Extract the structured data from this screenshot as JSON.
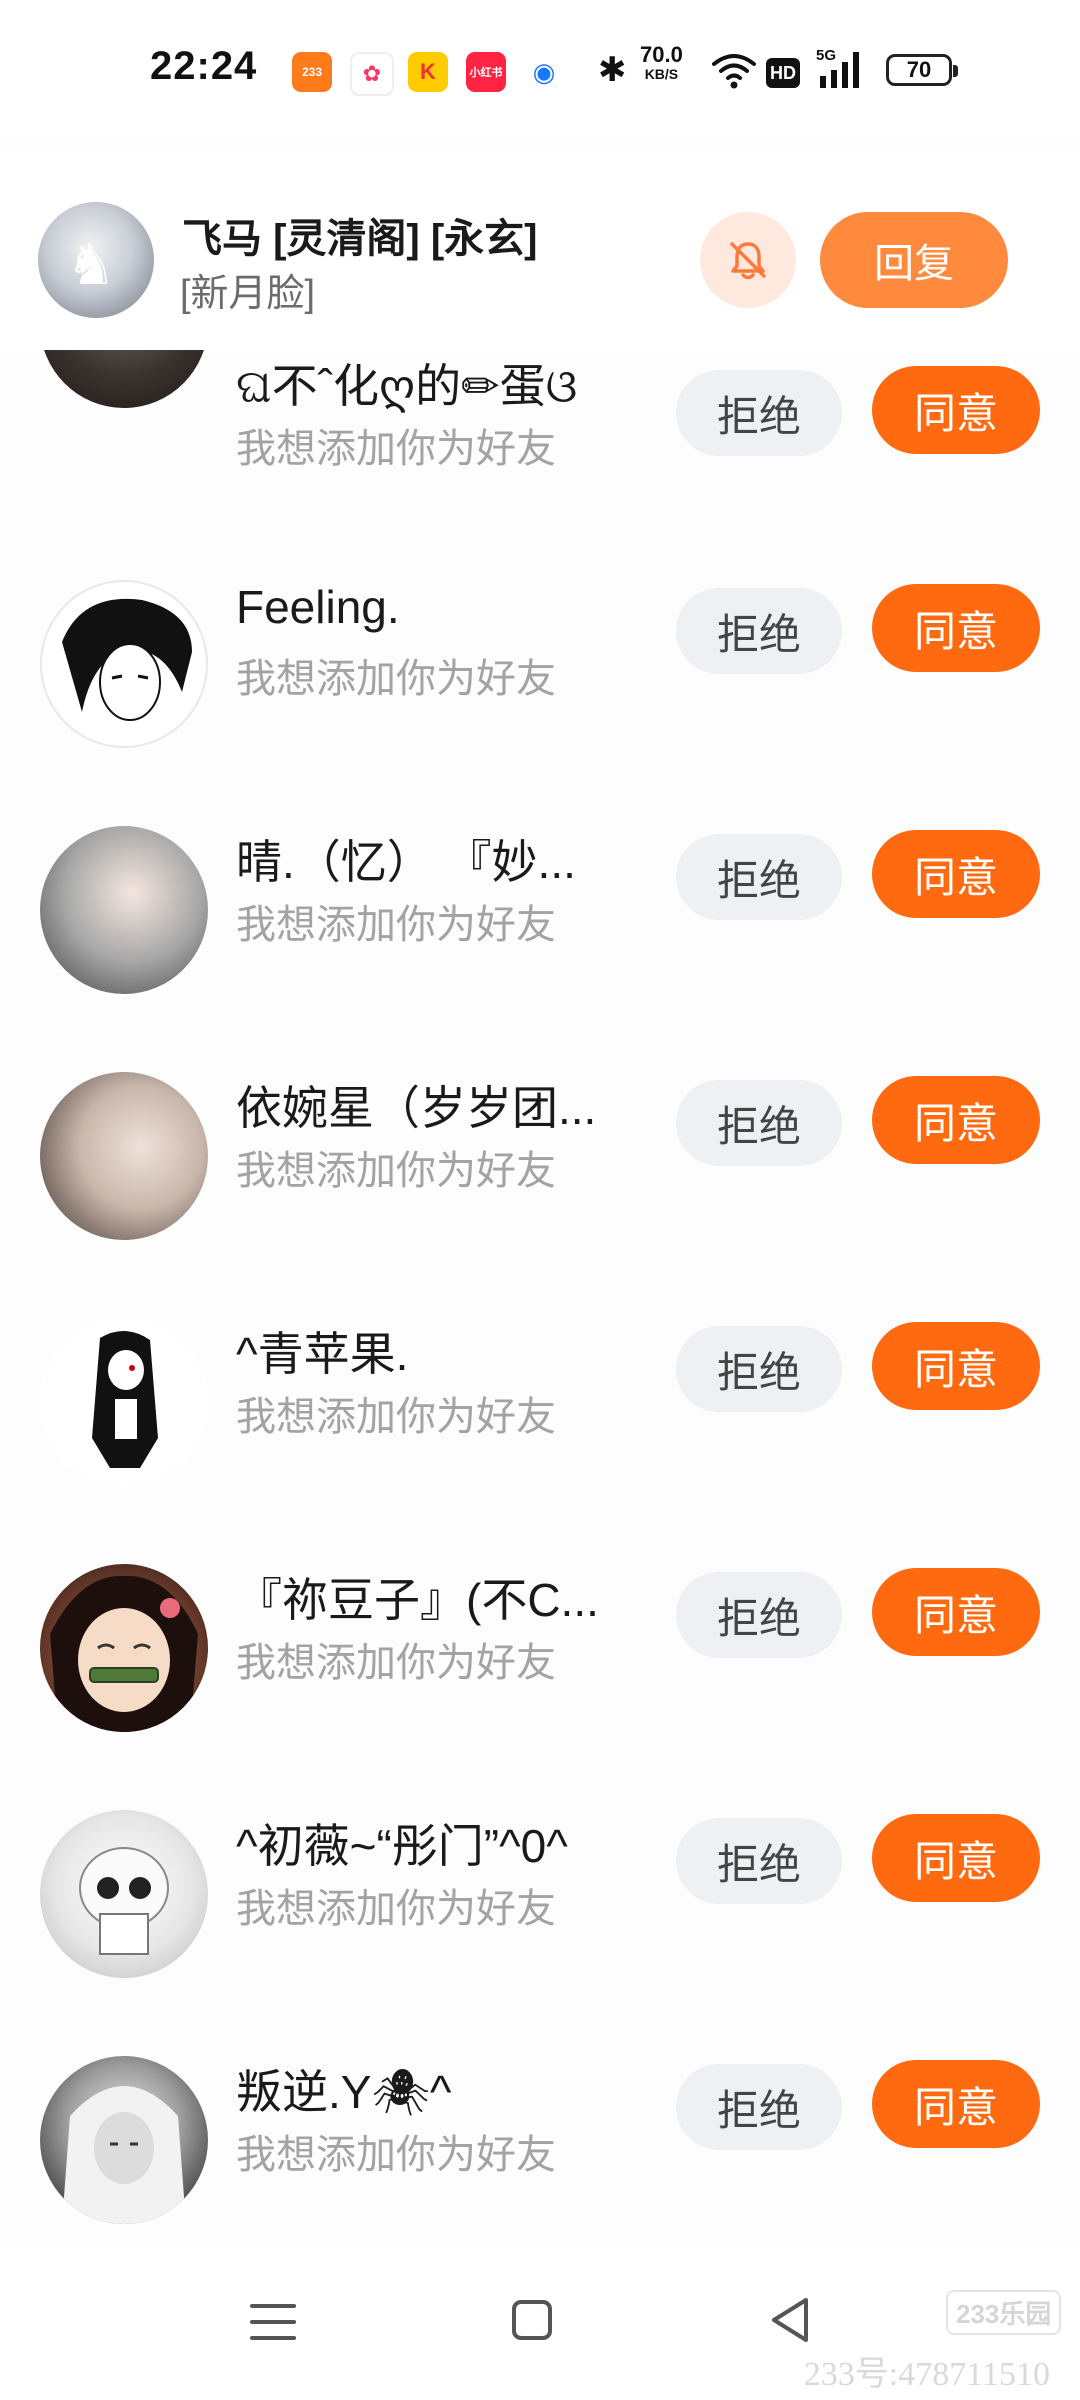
{
  "status_bar": {
    "time": "22:24",
    "app_icons": [
      "233",
      "✿",
      "K",
      "小红书",
      "◉"
    ],
    "net_speed": "70.0",
    "net_speed_unit": "KB/S",
    "hd_label": "HD",
    "signal_label": "5G",
    "battery": "70"
  },
  "notification": {
    "title": "飞马 [灵清阁] [永玄]",
    "subtitle": "[新月脸]",
    "reply_label": "回复",
    "accent_color": "#ff8a3d"
  },
  "request_defaults": {
    "reject_label": "拒绝",
    "accept_label": "同意",
    "accept_color": "#ff6a10"
  },
  "requests": [
    {
      "name": "ଘ不ˆ化ღ的✏蛋ଓ",
      "message": "我想添加你为好友",
      "reject_label": "拒绝",
      "accept_label": "同意"
    },
    {
      "name": "Feeling.",
      "message": "我想添加你为好友",
      "reject_label": "拒绝",
      "accept_label": "同意"
    },
    {
      "name": "晴.（忆）  『妙...",
      "message": "我想添加你为好友",
      "reject_label": "拒绝",
      "accept_label": "同意"
    },
    {
      "name": "依婉星（岁岁团...",
      "message": "我想添加你为好友",
      "reject_label": "拒绝",
      "accept_label": "同意"
    },
    {
      "name": "^青苹果.",
      "message": "我想添加你为好友",
      "reject_label": "拒绝",
      "accept_label": "同意"
    },
    {
      "name": "『祢豆子』(不C...",
      "message": "我想添加你为好友",
      "reject_label": "拒绝",
      "accept_label": "同意"
    },
    {
      "name": "^初薇~“彤门”^0^",
      "message": "我想添加你为好友",
      "reject_label": "拒绝",
      "accept_label": "同意"
    },
    {
      "name": "叛逆.Y🕷^",
      "message": "我想添加你为好友",
      "reject_label": "拒绝",
      "accept_label": "同意"
    }
  ],
  "watermark": {
    "logo": "233乐园",
    "id": "233号:478711510"
  }
}
